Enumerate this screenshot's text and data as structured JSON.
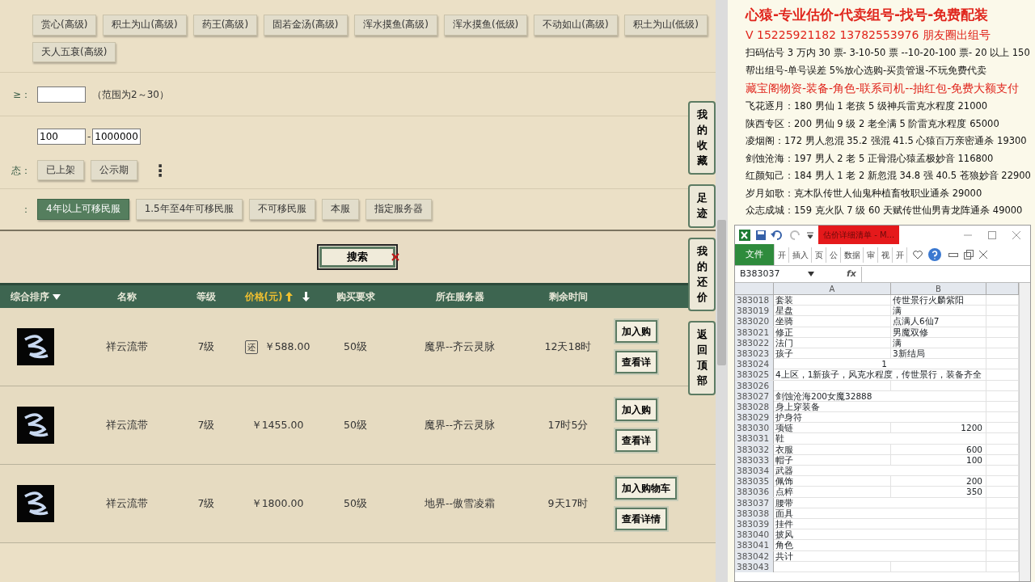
{
  "skills": [
    "赏心(高级)",
    "积土为山(高级)",
    "药王(高级)",
    "固若金汤(高级)",
    "浑水摸鱼(高级)",
    "浑水摸鱼(低级)",
    "不动如山(高级)",
    "积土为山(低级)",
    "天人五衰(高级)"
  ],
  "value_filter": {
    "label": "≥：",
    "hint": "（范围为2～30）"
  },
  "price_filter": {
    "from": "100",
    "separator": "-",
    "to": "1000000"
  },
  "status_filter": {
    "label": "态：",
    "options": [
      "已上架",
      "公示期"
    ],
    "more": "⋮"
  },
  "server_filter": {
    "label": "：",
    "options": [
      {
        "label": "4年以上可移民服",
        "selected": true
      },
      {
        "label": "1.5年至4年可移民服",
        "selected": false
      },
      {
        "label": "不可移民服",
        "selected": false
      },
      {
        "label": "本服",
        "selected": false
      },
      {
        "label": "指定服务器",
        "selected": false
      }
    ]
  },
  "search_button": "搜索",
  "table": {
    "columns": [
      {
        "label": "综合排序",
        "kind": "dropdown",
        "selected": false
      },
      {
        "label": "名称",
        "kind": "plain",
        "selected": false
      },
      {
        "label": "等级",
        "kind": "plain",
        "selected": false
      },
      {
        "label": "价格(元)",
        "kind": "sort",
        "selected": true
      },
      {
        "label": "购买要求",
        "kind": "plain",
        "selected": false
      },
      {
        "label": "所在服务器",
        "kind": "plain",
        "selected": false
      },
      {
        "label": "剩余时间",
        "kind": "plain",
        "selected": false
      }
    ],
    "rows": [
      {
        "name": "祥云流带",
        "level": "7级",
        "badge": "还",
        "price": "￥588.00",
        "requirement": "50级",
        "server": "魔界--齐云灵脉",
        "time_left": "12天18时",
        "actions": [
          "加入购",
          "查看详"
        ]
      },
      {
        "name": "祥云流带",
        "level": "7级",
        "price": "￥1455.00",
        "requirement": "50级",
        "server": "魔界--齐云灵脉",
        "time_left": "17时5分",
        "actions": [
          "加入购",
          "查看详"
        ]
      },
      {
        "name": "祥云流带",
        "level": "7级",
        "price": "￥1800.00",
        "requirement": "50级",
        "server": "地界--傲雪凌霜",
        "time_left": "9天17时",
        "actions": [
          "加入购物车",
          "查看详情"
        ]
      }
    ]
  },
  "side_tabs": [
    "我的收藏",
    "足迹",
    "我的还价",
    "返回顶部"
  ],
  "notes": [
    {
      "text": "心猿-专业估价-代卖组号-找号-免费配装",
      "kind": "headline"
    },
    {
      "text": "V 15225921182   13782553976 朋友圈出组号",
      "kind": "highlight"
    },
    {
      "text": "扫码估号 3 万内 30 票- 3-10-50 票  --10-20-100 票- 20 以上 150",
      "kind": "plain"
    },
    {
      "text": "帮出组号-单号误差 5%放心选购-买贵管退-不玩免费代卖",
      "kind": "plain"
    },
    {
      "text": "藏宝阁物资-装备-角色-联系司机--抽红包-免费大额支付",
      "kind": "highlight"
    },
    {
      "text": "飞花逐月：180 男仙 1 老孩 5 级神兵雷克水程度 21000",
      "kind": "plain"
    },
    {
      "text": "陕西专区：200 男仙 9 级 2 老全满 5 阶雷克水程度 65000",
      "kind": "plain"
    },
    {
      "text": "凌烟阁：172 男人忽混 35.2 强混 41.5 心猿百万亲密通杀 19300",
      "kind": "plain"
    },
    {
      "text": "剑蚀沧海：197 男人 2 老 5 正骨混心猿孟极妙音 116800",
      "kind": "plain"
    },
    {
      "text": "红颜知己：184 男人 1 老 2 新忽混 34.8 强 40.5 苍狼妙音 22900",
      "kind": "plain"
    },
    {
      "text": "岁月如歌：克木队传世人仙鬼种植畜牧职业通杀 29000",
      "kind": "plain"
    },
    {
      "text": "众志成城：159 克火队 7 级 60 天赋传世仙男青龙阵通杀 49000",
      "kind": "plain"
    }
  ],
  "excel": {
    "title": "估价详细清单 - M...",
    "ribbon_tabs": [
      {
        "label": "文件",
        "selected": true
      },
      {
        "label": "开",
        "selected": false
      },
      {
        "label": "插入",
        "selected": false
      },
      {
        "label": "页",
        "selected": false
      },
      {
        "label": "公",
        "selected": false
      },
      {
        "label": "数据",
        "selected": false
      },
      {
        "label": "审",
        "selected": false
      },
      {
        "label": "视",
        "selected": false
      },
      {
        "label": "开",
        "selected": false
      }
    ],
    "name_box": "B383037",
    "fx": "fx",
    "columns": [
      "A",
      "B"
    ],
    "rows": [
      {
        "number": "383018",
        "a": "套装",
        "b": "传世景行火麟紫阳"
      },
      {
        "number": "383019",
        "a": "星盘",
        "b": "满"
      },
      {
        "number": "383020",
        "a": "坐骑",
        "b": "点满人6仙7"
      },
      {
        "number": "383021",
        "a": "修正",
        "b": "男魔双修"
      },
      {
        "number": "383022",
        "a": "法门",
        "b": "满"
      },
      {
        "number": "383023",
        "a": "孩子",
        "b": "3新结局"
      },
      {
        "number": "383024",
        "a": "1",
        "right_aligned": true
      },
      {
        "number": "383025",
        "a": "4上区，1新孩子，风克水程度，传世景行，装备齐全"
      },
      {
        "number": "383026"
      },
      {
        "number": "383027",
        "a": "剑蚀沧海200女魔32888"
      },
      {
        "number": "383028",
        "a": "身上穿装备"
      },
      {
        "number": "383029",
        "a": "护身符"
      },
      {
        "number": "383030",
        "a": "项链",
        "b": "1200",
        "right_aligned": true
      },
      {
        "number": "383031",
        "a": "鞋"
      },
      {
        "number": "383032",
        "a": "衣服",
        "b": "600",
        "right_aligned": true
      },
      {
        "number": "383033",
        "a": "帽子",
        "b": "100",
        "right_aligned": true
      },
      {
        "number": "383034",
        "a": "武器"
      },
      {
        "number": "383035",
        "a": "佩饰",
        "b": "200",
        "right_aligned": true
      },
      {
        "number": "383036",
        "a": "点粹",
        "b": "350",
        "right_aligned": true
      },
      {
        "number": "383037",
        "a": "腰带"
      },
      {
        "number": "383038",
        "a": "面具"
      },
      {
        "number": "383039",
        "a": "挂件"
      },
      {
        "number": "383040",
        "a": "披风"
      },
      {
        "number": "383041",
        "a": "角色"
      },
      {
        "number": "383042",
        "a": "共计"
      },
      {
        "number": "383043"
      }
    ]
  }
}
